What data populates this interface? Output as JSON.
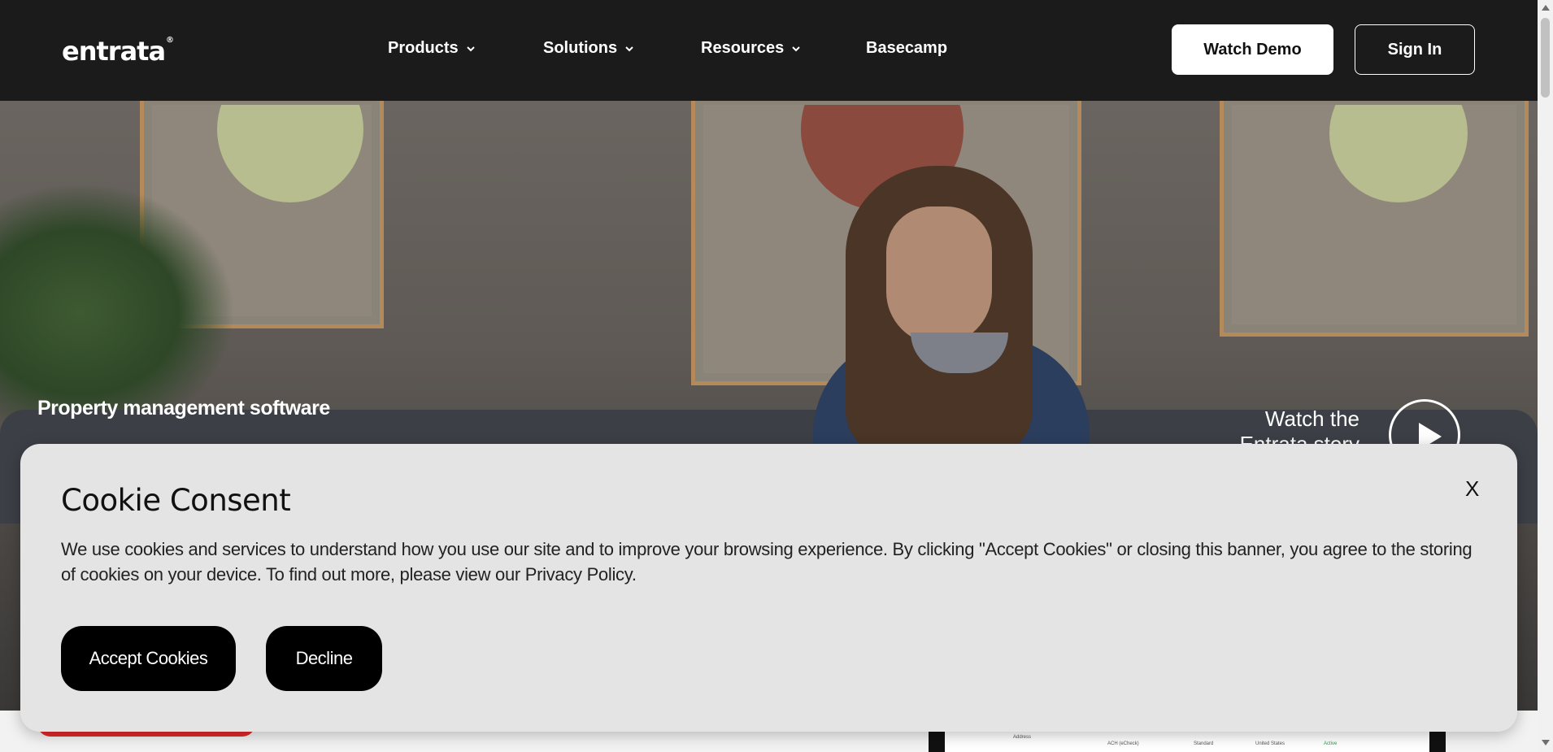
{
  "header": {
    "logo_text": "entrata",
    "logo_mark": "®",
    "nav": [
      {
        "label": "Products",
        "icon": "chevron-down-icon"
      },
      {
        "label": "Solutions",
        "icon": "chevron-down-icon"
      },
      {
        "label": "Resources",
        "icon": "chevron-down-icon"
      },
      {
        "label": "Basecamp"
      }
    ],
    "watch_demo_label": "Watch Demo",
    "sign_in_label": "Sign In"
  },
  "hero": {
    "tagline": "Property management software",
    "watch_story_label": "Watch the Entrata story",
    "play_icon": "play-icon"
  },
  "cookie_banner": {
    "title": "Cookie Consent",
    "body": "We use cookies and services to understand how you use our site and to improve your browsing experience. By clicking \"Accept Cookies\" or closing this banner, you agree to the storing of cookies on your device. To find out more, please view our Privacy Policy.",
    "close_label": "X",
    "accept_label": "Accept Cookies",
    "decline_label": "Decline"
  },
  "device_preview": {
    "field_label": "Address",
    "cols": [
      "ACH (eCheck)",
      "Standard",
      "United States",
      "Active"
    ]
  },
  "colors": {
    "header_bg": "#1b1b1b",
    "cookie_bg": "#e4e4e4",
    "accent_red": "#e02a2a"
  }
}
